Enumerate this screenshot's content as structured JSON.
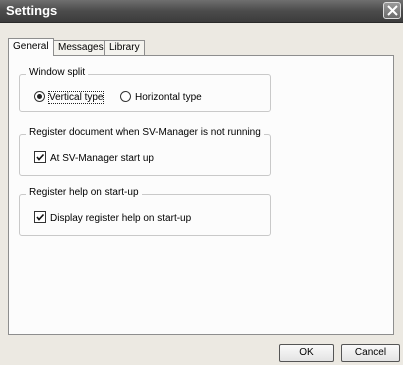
{
  "window": {
    "title": "Settings"
  },
  "tabs": [
    {
      "label": "General",
      "active": true
    },
    {
      "label": "Messages",
      "active": false
    },
    {
      "label": "Library",
      "active": false
    }
  ],
  "groups": {
    "window_split": {
      "title": "Window split",
      "options": [
        {
          "label": "Vertical type",
          "selected": true
        },
        {
          "label": "Horizontal type",
          "selected": false
        }
      ]
    },
    "register_document": {
      "title": "Register document when SV-Manager is not running",
      "checkbox": {
        "label": "At SV-Manager start up",
        "checked": true
      }
    },
    "register_help": {
      "title": "Register help on start-up",
      "checkbox": {
        "label": "Display register help on start-up",
        "checked": true
      }
    }
  },
  "buttons": {
    "ok": "OK",
    "cancel": "Cancel"
  },
  "icons": {
    "close": "close-icon",
    "check": "checkmark-icon"
  }
}
